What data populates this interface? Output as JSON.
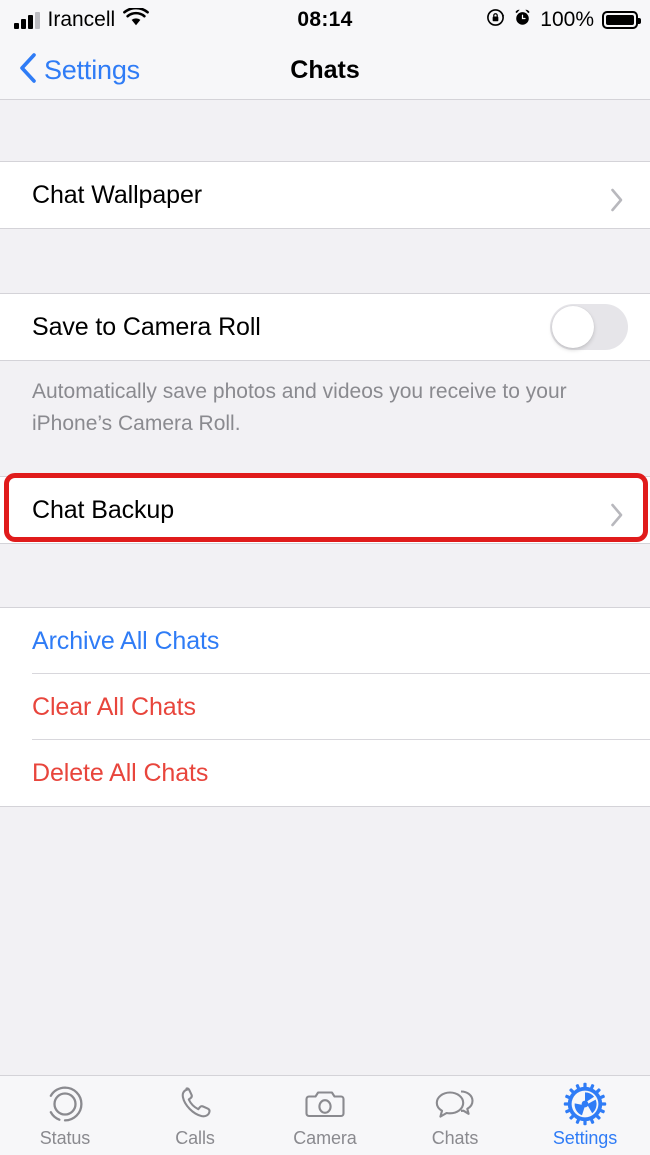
{
  "status_bar": {
    "carrier": "Irancell",
    "time": "08:14",
    "battery_percent": "100%",
    "signal_icon": "signal-bars-icon",
    "wifi_icon": "wifi-icon",
    "rotation_lock_icon": "rotation-lock-icon",
    "alarm_icon": "alarm-clock-icon",
    "battery_icon": "battery-full-icon"
  },
  "nav": {
    "back_label": "Settings",
    "back_icon": "chevron-left-icon",
    "title": "Chats"
  },
  "sections": {
    "wallpaper": {
      "row_label": "Chat Wallpaper",
      "chevron_icon": "chevron-right-icon"
    },
    "media": {
      "row_label": "Save to Camera Roll",
      "toggle_state": "off",
      "footnote": "Automatically save photos and videos you receive to your iPhone’s Camera Roll."
    },
    "backup": {
      "row_label": "Chat Backup",
      "chevron_icon": "chevron-right-icon",
      "highlighted": "true"
    },
    "actions": {
      "items": [
        {
          "label": "Archive All Chats",
          "style": "blue"
        },
        {
          "label": "Clear All Chats",
          "style": "red"
        },
        {
          "label": "Delete All Chats",
          "style": "red"
        }
      ]
    }
  },
  "tabbar": {
    "tabs": [
      {
        "label": "Status",
        "icon": "status-rings-icon",
        "active": "false"
      },
      {
        "label": "Calls",
        "icon": "phone-icon",
        "active": "false"
      },
      {
        "label": "Camera",
        "icon": "camera-icon",
        "active": "false"
      },
      {
        "label": "Chats",
        "icon": "speech-bubbles-icon",
        "active": "false"
      },
      {
        "label": "Settings",
        "icon": "gear-icon",
        "active": "true"
      }
    ]
  },
  "colors": {
    "accent_blue": "#2F7CF6",
    "destructive_red": "#E8453C",
    "highlight_red": "#E01B1B",
    "group_background": "#F2F1F4",
    "row_background": "#FFFFFF",
    "secondary_text": "#8A8A8F"
  }
}
